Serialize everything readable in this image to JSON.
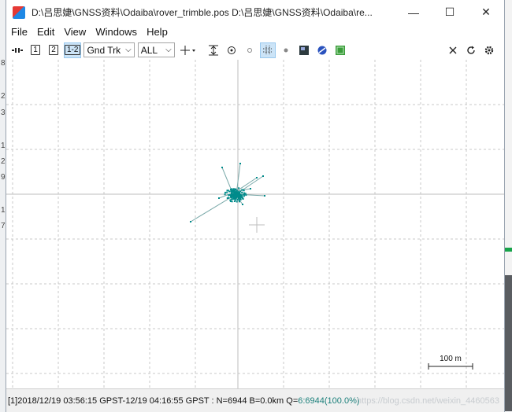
{
  "window": {
    "title": "D:\\吕思婕\\GNSS资料\\Odaiba\\rover_trimble.pos D:\\吕思婕\\GNSS资料\\Odaiba\\re...",
    "minimize": "—",
    "maximize": "☐",
    "close": "✕"
  },
  "menu": [
    "File",
    "Edit",
    "View",
    "Windows",
    "Help"
  ],
  "toolbar": {
    "btn1": "1",
    "btn2": "2",
    "btn12": "1-2",
    "plot_type": "Gnd Trk",
    "solution_filter": "ALL"
  },
  "plot": {
    "scale_label": "100 m",
    "colors": {
      "track": "#008b8b",
      "grid": "#c8c8c8",
      "axis": "#bdbdbd"
    }
  },
  "status": {
    "text": "[1]2018/12/19 03:56:15 GPST-12/19 04:16:55 GPST : N=6944 B=0.0km Q=",
    "q_value": "6:6944(100.0%)",
    "watermark": "https://blog.csdn.net/weixin_4460563"
  },
  "background": {
    "fragments": [
      "8",
      "2",
      "3",
      "1",
      "2",
      "9",
      "1",
      "7"
    ]
  }
}
